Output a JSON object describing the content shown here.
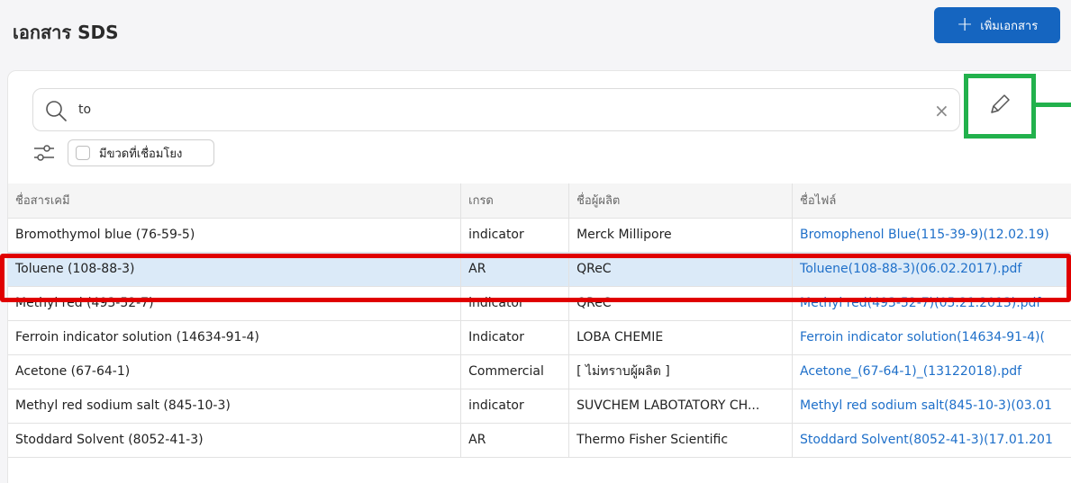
{
  "page": {
    "title": "เอกสาร SDS"
  },
  "toolbar": {
    "add_label": "เพิ่มเอกสาร"
  },
  "search": {
    "value": "to"
  },
  "filters": {
    "linked_label": "มีขวดที่เชื่อมโยง"
  },
  "table": {
    "headers": [
      "ชื่อสารเคมี",
      "เกรด",
      "ชื่อผู้ผลิต",
      "ชื่อไฟล์"
    ],
    "rows": [
      [
        "Bromothymol blue (76-59-5)",
        "indicator",
        "Merck Millipore",
        "Bromophenol Blue(115-39-9)(12.02.19)"
      ],
      [
        "Toluene (108-88-3)",
        "AR",
        "QReC",
        "Toluene(108-88-3)(06.02.2017).pdf"
      ],
      [
        "Methyl red (493-52-7)",
        "indicator",
        "QReC",
        "Methyl red(493-52-7)(05.21.2013).pdf"
      ],
      [
        "Ferroin indicator solution (14634-91-4)",
        "Indicator",
        "LOBA CHEMIE",
        "Ferroin indicator solution(14634-91-4)("
      ],
      [
        "Acetone (67-64-1)",
        "Commercial",
        "[ ไม่ทราบผู้ผลิต ]",
        "Acetone_(67-64-1)_(13122018).pdf"
      ],
      [
        "Methyl red sodium salt (845-10-3)",
        "indicator",
        "SUVCHEM LABOTATORY CH...",
        "Methyl red sodium salt(845-10-3)(03.01"
      ],
      [
        "Stoddard Solvent (8052-41-3)",
        "AR",
        "Thermo Fisher Scientific",
        "Stoddard Solvent(8052-41-3)(17.01.201"
      ]
    ]
  },
  "colors": {
    "accent": "#1565c0",
    "link": "#1e6fc9",
    "selected_row": "#dbeaf8",
    "annotation_red": "#e00000",
    "annotation_green": "#22b14c"
  }
}
